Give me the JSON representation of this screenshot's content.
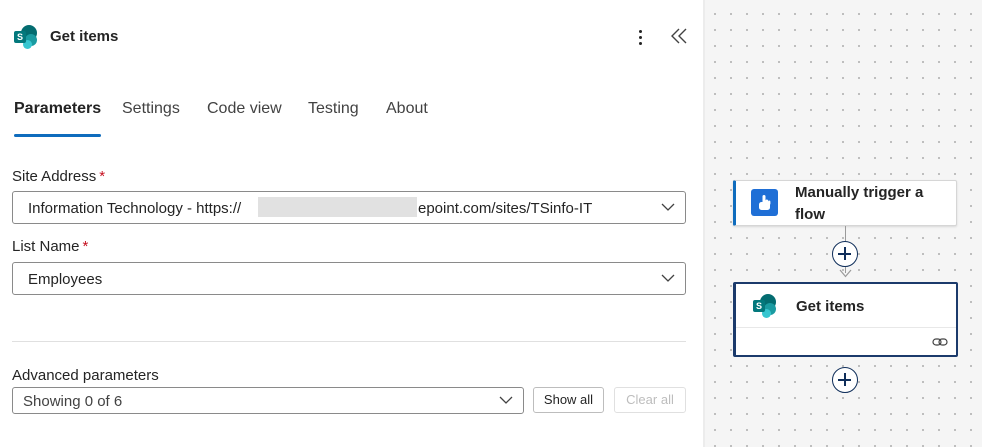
{
  "panel": {
    "title": "Get items",
    "tabs": [
      "Parameters",
      "Settings",
      "Code view",
      "Testing",
      "About"
    ],
    "active_tab": "Parameters"
  },
  "fields": {
    "site_address": {
      "label": "Site Address",
      "required_mark": "*",
      "value": "Information Technology - https://",
      "value_suffix": "epoint.com/sites/TSinfo-IT"
    },
    "list_name": {
      "label": "List Name",
      "required_mark": "*",
      "value": "Employees"
    }
  },
  "advanced": {
    "label": "Advanced parameters",
    "value": "Showing 0 of 6",
    "show_all": "Show all",
    "clear_all": "Clear all"
  },
  "canvas": {
    "trigger_card": {
      "title": "Manually trigger a flow"
    },
    "action_card": {
      "title": "Get items"
    }
  },
  "icons": {
    "header_logo": "sharepoint-icon",
    "more": "more-vertical-icon",
    "collapse": "double-chevron-left-icon",
    "trigger": "touch-hand-icon",
    "link": "link-icon"
  },
  "colors": {
    "accent": "#0f6cbd",
    "required": "#c50f1f",
    "selected_card_border": "#1b3a6b",
    "trigger_icon_bg": "#1f6fd6"
  }
}
